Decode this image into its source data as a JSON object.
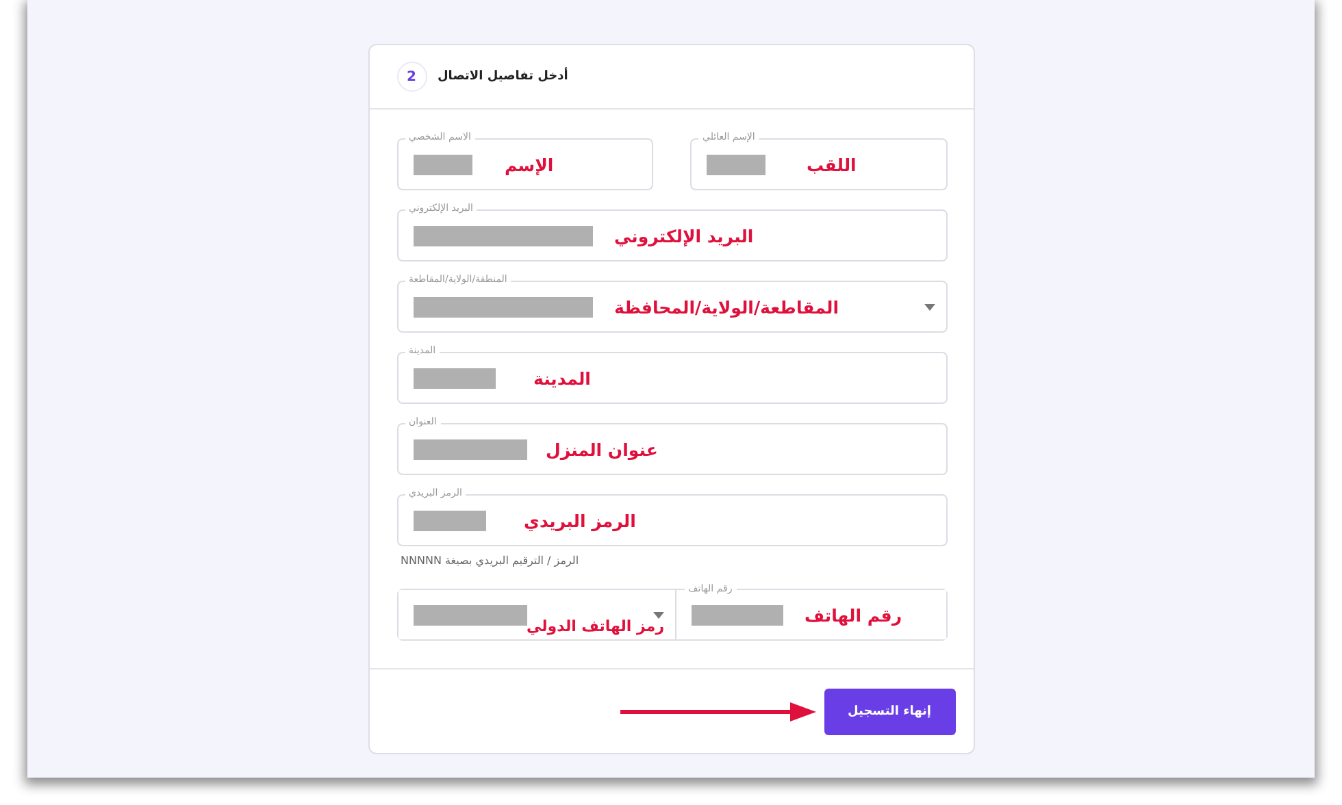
{
  "step": {
    "number": "2",
    "title": "أدخل تفاصيل الاتصال"
  },
  "rows": [
    {
      "kind": "pair",
      "fields": [
        {
          "label": "الإسم العائلي",
          "kind": "text",
          "annotation": "اللقب",
          "redacted": true
        },
        {
          "label": "الاسم الشخصي",
          "kind": "text",
          "annotation": "الإسم",
          "redacted": true
        }
      ]
    },
    {
      "kind": "single",
      "fields": [
        {
          "label": "البريد الإلكتروني",
          "kind": "text",
          "annotation": "البريد الإلكتروني",
          "redacted": true
        }
      ]
    },
    {
      "kind": "single",
      "fields": [
        {
          "label": "المنطقة/الولاية/المقاطعة",
          "kind": "select",
          "annotation": "المقاطعة/الولاية/المحافظة",
          "redacted": true
        }
      ]
    },
    {
      "kind": "single",
      "fields": [
        {
          "label": "المدينة",
          "kind": "text",
          "annotation": "المدينة",
          "redacted": true
        }
      ]
    },
    {
      "kind": "single",
      "fields": [
        {
          "label": "العنوان",
          "kind": "text",
          "annotation": "عنوان المنزل",
          "redacted": true
        }
      ]
    },
    {
      "kind": "single",
      "fields": [
        {
          "label": "الرمز البريدي",
          "kind": "text",
          "annotation": "الرمز البريدي",
          "redacted": true
        }
      ],
      "hint": "الرمز / الترقيم البريدي بصيغة NNNNN"
    },
    {
      "kind": "joined",
      "fields": [
        {
          "kind": "select",
          "annotation": "رمز الهاتف الدولي",
          "redacted": true
        },
        {
          "label": "رقم الهاتف",
          "kind": "text",
          "annotation": "رقم الهاتف",
          "redacted": true
        }
      ]
    }
  ],
  "submit": {
    "label": "إنهاء التسجيل"
  }
}
